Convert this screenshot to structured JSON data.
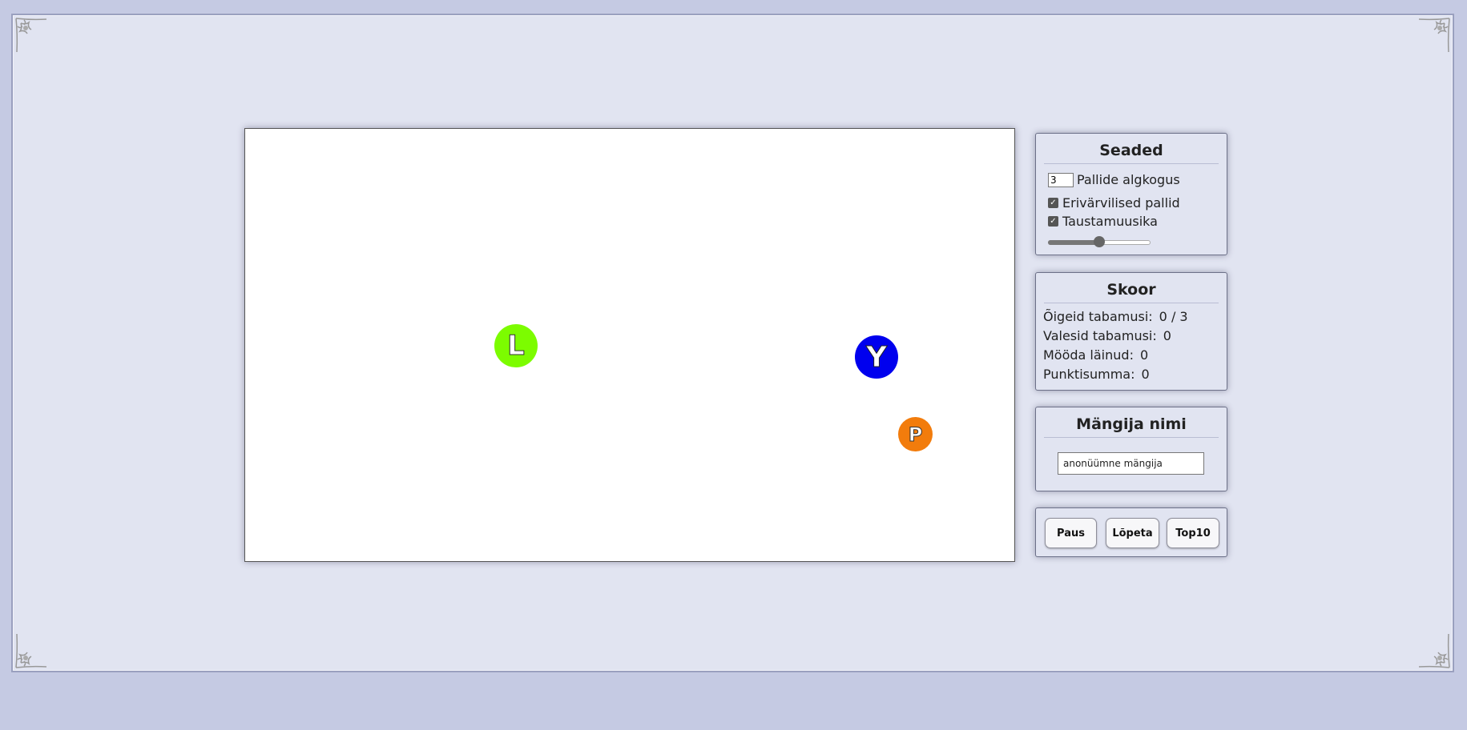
{
  "game": {
    "balls": [
      {
        "letter": "L",
        "color": "#7cfc00"
      },
      {
        "letter": "Y",
        "color": "#0000ee"
      },
      {
        "letter": "P",
        "color": "#f27c0c"
      }
    ]
  },
  "settings": {
    "title": "Seaded",
    "ball_count_value": "3",
    "ball_count_label": "Pallide algkogus",
    "colored_balls_label": "Erivärvilised pallid",
    "colored_balls_checked": true,
    "music_label": "Taustamuusika",
    "music_checked": true,
    "volume_fraction": 0.5
  },
  "score": {
    "title": "Skoor",
    "correct_label": "Õigeid tabamusi:",
    "correct_value": "0 / 3",
    "wrong_label": "Valesid tabamusi:",
    "wrong_value": "0",
    "missed_label": "Mööda läinud:",
    "missed_value": "0",
    "total_label": "Punktisumma:",
    "total_value": "0"
  },
  "player": {
    "title": "Mängija nimi",
    "name_value": "anonüümne mängija"
  },
  "controls": {
    "pause_label": "Paus",
    "end_label": "Lõpeta",
    "top10_label": "Top10"
  }
}
